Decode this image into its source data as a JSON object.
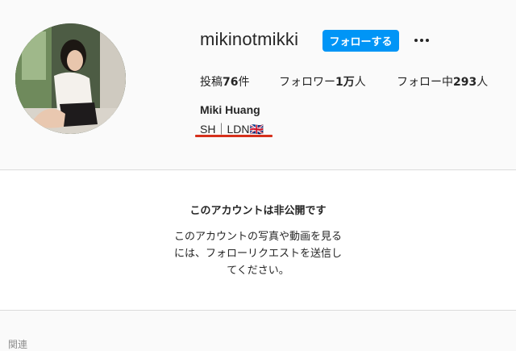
{
  "profile": {
    "username": "mikinotmikki",
    "follow_label": "フォローする",
    "more_icon": "more-horizontal-icon",
    "accent_color": "#0095f6",
    "stats": {
      "posts_label": "投稿",
      "posts_value": "76",
      "posts_suffix": "件",
      "followers_label": "フォロワー",
      "followers_value": "1万",
      "followers_suffix": "人",
      "following_label": "フォロー中",
      "following_value": "293",
      "following_suffix": "人"
    },
    "full_name": "Miki Huang",
    "bio": "SH｜LDN🇬🇧",
    "bio_highlight_color": "#d6301c"
  },
  "private_notice": {
    "title": "このアカウントは非公開です",
    "lines": [
      "このアカウントの写真や動画を見る",
      "には、フォローリクエストを送信し",
      "てください。"
    ]
  },
  "footer": {
    "partial_text": "関連"
  }
}
